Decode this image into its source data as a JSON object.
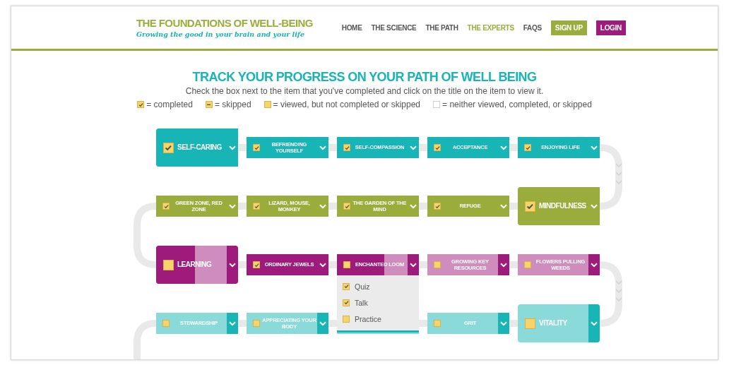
{
  "header": {
    "logo_title": "THE FOUNDATIONS OF WELL-BEING",
    "tagline": "Growing the good in your brain and your life",
    "nav": [
      {
        "label": "HOME",
        "kind": "link",
        "selected": false
      },
      {
        "label": "THE SCIENCE",
        "kind": "link",
        "selected": false
      },
      {
        "label": "THE PATH",
        "kind": "link",
        "selected": false
      },
      {
        "label": "THE EXPERTS",
        "kind": "link",
        "selected": true
      },
      {
        "label": "FAQS",
        "kind": "link",
        "selected": false
      },
      {
        "label": "SIGN UP",
        "kind": "button",
        "selected": false,
        "color": "#9aad3c"
      },
      {
        "label": "LOGIN",
        "kind": "button",
        "selected": false,
        "color": "#9e1a7b"
      }
    ]
  },
  "intro": {
    "title": "TRACK YOUR PROGRESS ON YOUR PATH OF WELL BEING",
    "instructions": "Check the box next to the item that you've completed and click on the title on the item to view it.",
    "legend": [
      {
        "kind": "completed",
        "label": "= completed"
      },
      {
        "kind": "skipped",
        "label": "= skipped"
      },
      {
        "kind": "viewed",
        "label": "= viewed, but not completed or skipped"
      },
      {
        "kind": "untouched",
        "label": "= neither viewed, completed, or skipped"
      }
    ]
  },
  "path": {
    "rows": [
      {
        "color": "#17b5b5",
        "nodes": [
          {
            "kind": "major",
            "title": "SELF-CARING",
            "checked": true,
            "level": 1,
            "expanded": false
          },
          {
            "kind": "minor",
            "title": "BEFRIENDING YOURSELF",
            "checked": true,
            "level": 1,
            "expanded": false
          },
          {
            "kind": "minor",
            "title": "SELF-COMPASSION",
            "checked": true,
            "level": 1,
            "expanded": false
          },
          {
            "kind": "minor",
            "title": "ACCEPTANCE",
            "checked": true,
            "level": 1,
            "expanded": false
          },
          {
            "kind": "minor",
            "title": "ENJOYING LIFE",
            "checked": true,
            "level": 1,
            "expanded": false
          }
        ]
      },
      {
        "color": "#9aad3c",
        "nodes": [
          {
            "kind": "minor",
            "title": "GREEN ZONE, RED ZONE",
            "checked": true,
            "level": 1,
            "expanded": false
          },
          {
            "kind": "minor",
            "title": "LIZARD, MOUSE, MONKEY",
            "checked": true,
            "level": 1,
            "expanded": false
          },
          {
            "kind": "minor",
            "title": "THE GARDEN OF THE MIND",
            "checked": true,
            "level": 1,
            "expanded": false
          },
          {
            "kind": "minor",
            "title": "REFUGE",
            "checked": true,
            "level": 1,
            "expanded": false
          },
          {
            "kind": "major",
            "title": "MINDFULNESS",
            "checked": true,
            "level": 1,
            "expanded": false
          }
        ]
      },
      {
        "color": "#9e1a7b",
        "nodes": [
          {
            "kind": "major",
            "title": "LEARNING",
            "checked": false,
            "viewed": true,
            "level": 0.47,
            "expanded": false
          },
          {
            "kind": "minor",
            "title": "ORDINARY JEWELS",
            "checked": true,
            "level": 1,
            "expanded": false
          },
          {
            "kind": "minor",
            "title": "ENCHANTED LOOM",
            "checked": false,
            "viewed": true,
            "level": 0.58,
            "expanded": true,
            "items": [
              {
                "label": "Quiz",
                "checked": true
              },
              {
                "label": "Talk",
                "checked": true
              },
              {
                "label": "Practice",
                "checked": false,
                "viewed": true
              }
            ]
          },
          {
            "kind": "minor",
            "title": "GROWING KEY RESOURCES",
            "checked": false,
            "viewed": true,
            "level": 0,
            "expanded": false
          },
          {
            "kind": "minor",
            "title": "FLOWERS PULLING WEEDS",
            "checked": false,
            "viewed": true,
            "level": 0,
            "expanded": false
          }
        ]
      },
      {
        "color": "#17b5b5",
        "nodes": [
          {
            "kind": "minor",
            "title": "STEWARDSHIP",
            "checked": false,
            "viewed": true,
            "level": 0,
            "expanded": false
          },
          {
            "kind": "minor",
            "title": "APPRECIATING YOUR BODY",
            "checked": false,
            "viewed": true,
            "level": 0,
            "expanded": false
          },
          {
            "kind": "covered",
            "level": 0
          },
          {
            "kind": "minor",
            "title": "GRIT",
            "checked": false,
            "viewed": true,
            "level": 0,
            "expanded": false
          },
          {
            "kind": "major",
            "title": "VITALITY",
            "checked": false,
            "viewed": true,
            "level": 0,
            "expanded": false
          }
        ]
      }
    ]
  }
}
